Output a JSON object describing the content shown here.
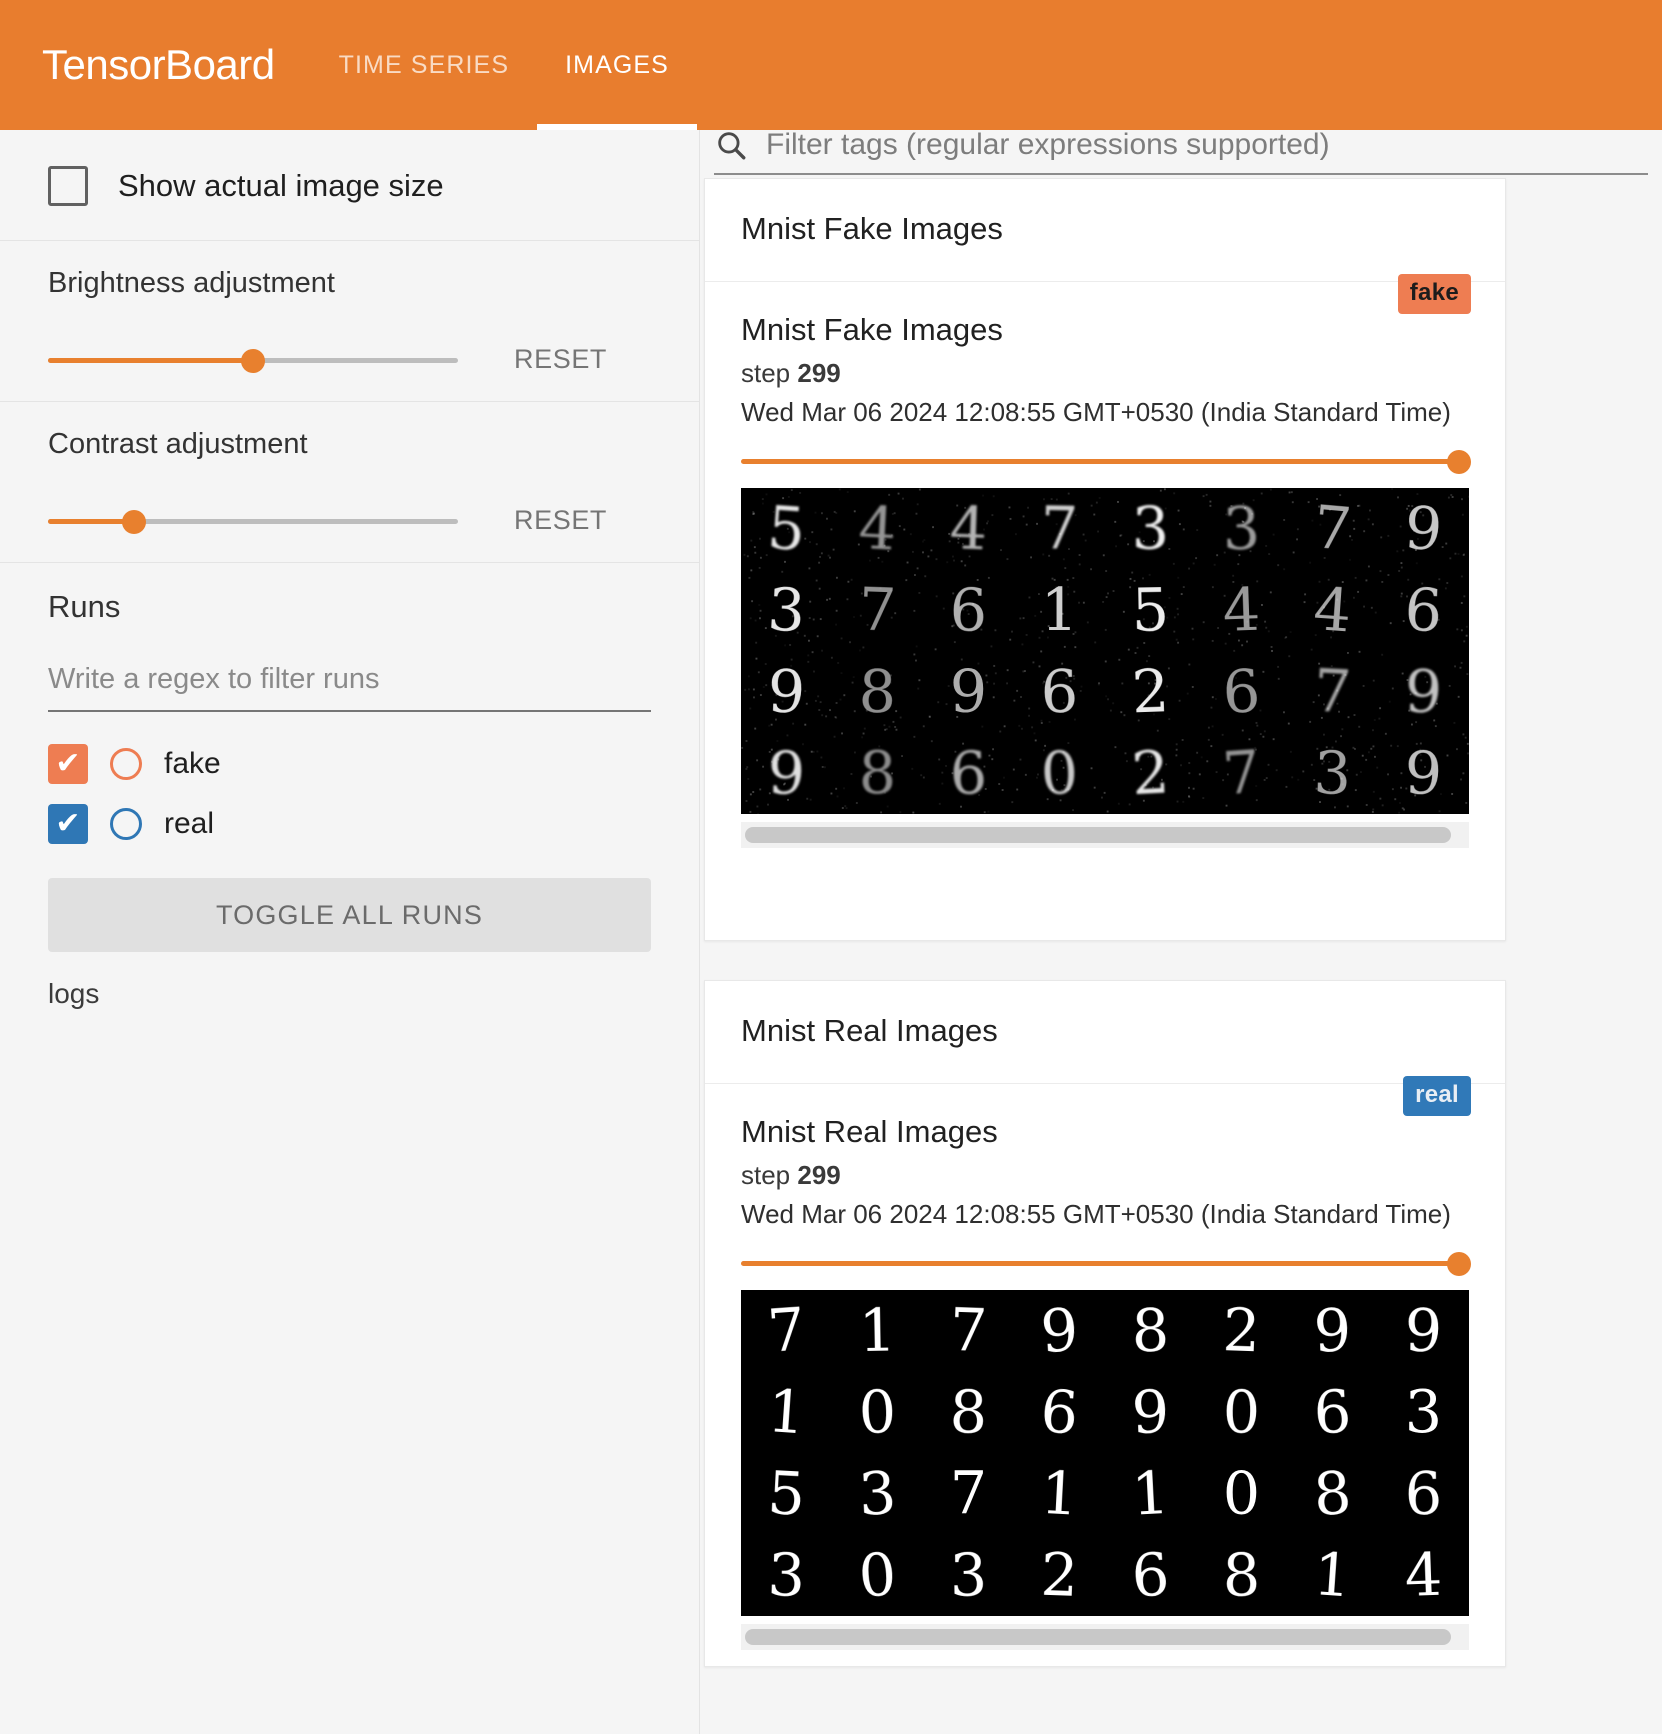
{
  "header": {
    "brand": "TensorBoard",
    "tabs": [
      {
        "label": "TIME SERIES",
        "active": false
      },
      {
        "label": "IMAGES",
        "active": true
      }
    ]
  },
  "sidebar": {
    "show_actual_size": {
      "label": "Show actual image size",
      "checked": false
    },
    "brightness": {
      "label": "Brightness adjustment",
      "reset_label": "RESET",
      "value_pct": 50
    },
    "contrast": {
      "label": "Contrast adjustment",
      "reset_label": "RESET",
      "value_pct": 21
    },
    "runs": {
      "title": "Runs",
      "filter_placeholder": "Write a regex to filter runs",
      "filter_value": "",
      "items": [
        {
          "name": "fake",
          "checked": true,
          "color": "#ee7d52"
        },
        {
          "name": "real",
          "checked": true,
          "color": "#2f77b5"
        }
      ],
      "toggle_all_label": "TOGGLE ALL RUNS",
      "logs_label": "logs"
    }
  },
  "search": {
    "placeholder": "Filter tags (regular expressions supported)",
    "value": "",
    "icon": "search-icon"
  },
  "cards": [
    {
      "group_title": "Mnist Fake Images",
      "title": "Mnist Fake Images",
      "step_label": "step",
      "step_value": "299",
      "timestamp": "Wed Mar 06 2024 12:08:55 GMT+0530 (India Standard Time)",
      "badge": "fake",
      "badge_kind": "fake",
      "slider_pct": 100,
      "image_kind": "mnist-fake-grid",
      "digits": [
        [
          "5",
          "4",
          "4",
          "7",
          "3",
          "3",
          "7",
          "9"
        ],
        [
          "3",
          "7",
          "6",
          "1",
          "5",
          "4",
          "4",
          "6"
        ],
        [
          "9",
          "8",
          "9",
          "6",
          "2",
          "6",
          "7",
          "9"
        ],
        [
          "9",
          "8",
          "6",
          "0",
          "2",
          "7",
          "3",
          "9"
        ]
      ]
    },
    {
      "group_title": "Mnist Real Images",
      "title": "Mnist Real Images",
      "step_label": "step",
      "step_value": "299",
      "timestamp": "Wed Mar 06 2024 12:08:55 GMT+0530 (India Standard Time)",
      "badge": "real",
      "badge_kind": "real",
      "slider_pct": 100,
      "image_kind": "mnist-real-grid",
      "digits": [
        [
          "7",
          "1",
          "7",
          "9",
          "8",
          "2",
          "9",
          "9"
        ],
        [
          "1",
          "0",
          "8",
          "6",
          "9",
          "0",
          "6",
          "3"
        ],
        [
          "5",
          "3",
          "7",
          "1",
          "1",
          "0",
          "8",
          "6"
        ],
        [
          "3",
          "0",
          "3",
          "2",
          "6",
          "8",
          "1",
          "4"
        ]
      ]
    }
  ],
  "colors": {
    "accent": "#e87d2e",
    "fake": "#ee7d52",
    "real": "#2f77b5",
    "surface": "#ffffff",
    "page_bg": "#f5f5f5"
  }
}
